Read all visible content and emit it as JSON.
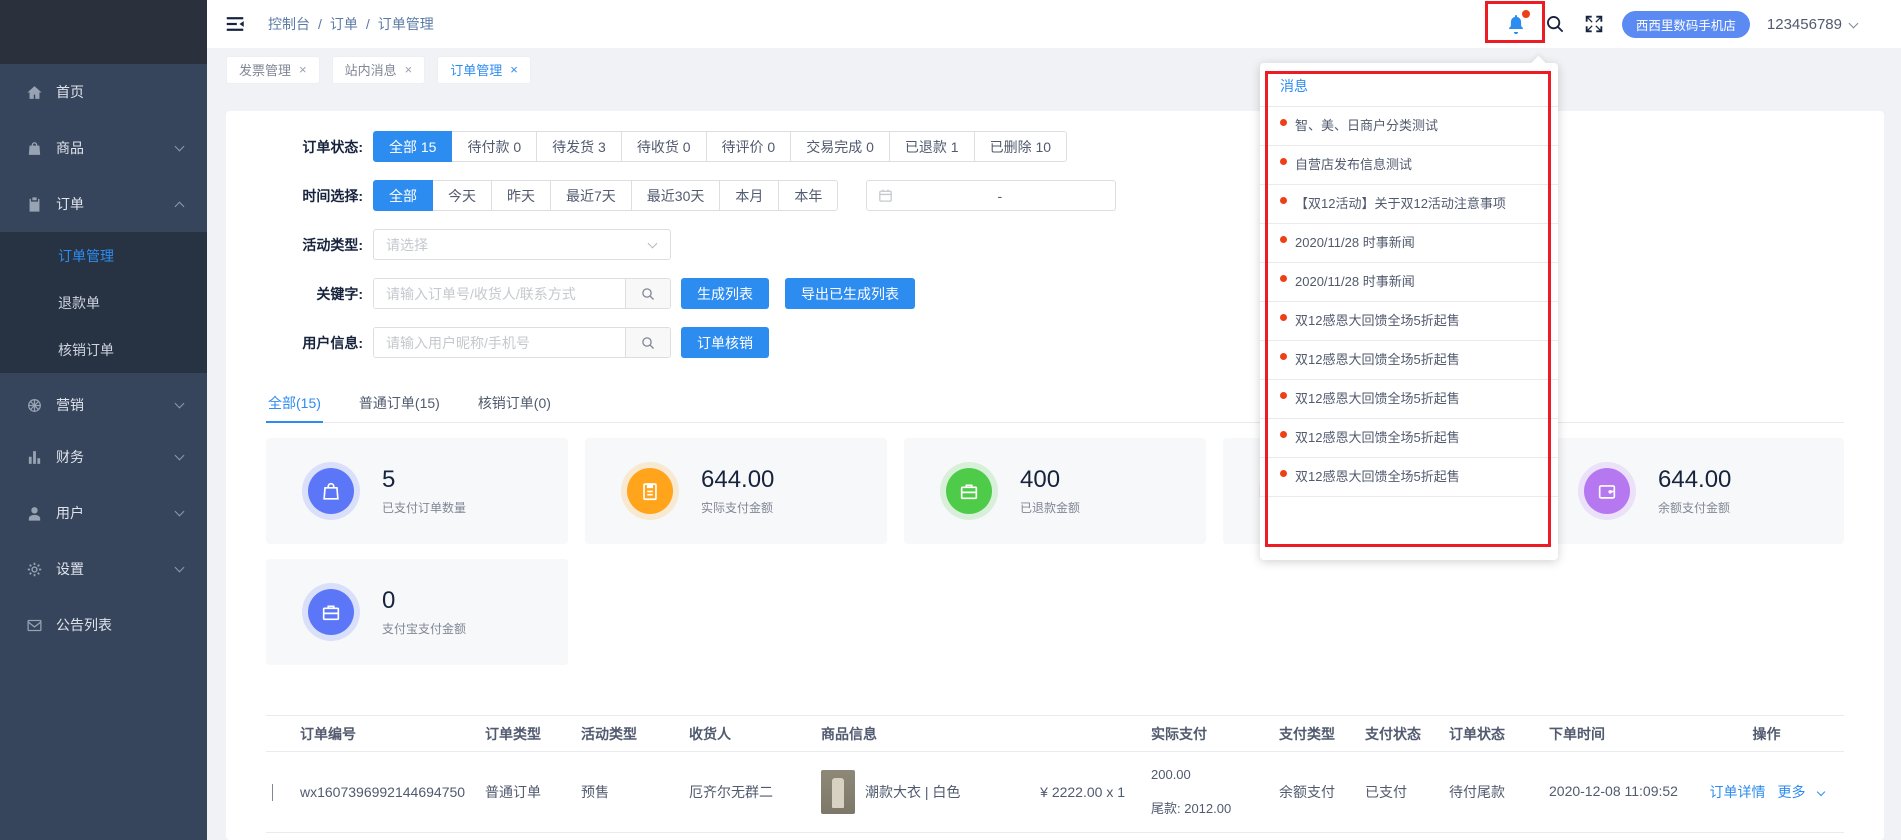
{
  "colors": {
    "accent": "#2d8cf0",
    "annotation_red": "#ed1c24",
    "unread_dot_red": "#ed4014",
    "sidebar_bg": "#36455b",
    "store_badge_bg": "#5a8af2"
  },
  "sidebar": {
    "items": [
      "首页",
      "商品",
      "订单",
      "营销",
      "财务",
      "用户",
      "设置",
      "公告列表"
    ],
    "order_submenu": [
      "订单管理",
      "退款单",
      "核销订单"
    ]
  },
  "header": {
    "breadcrumb": [
      "控制台",
      "订单",
      "订单管理"
    ],
    "separator": "/",
    "store_badge": "西西里数码手机店",
    "account": "123456789"
  },
  "tabbar": {
    "tabs": [
      "发票管理",
      "站内消息",
      "订单管理"
    ],
    "close_glyph": "×"
  },
  "filters": {
    "status_label": "订单状态:",
    "status_options": [
      "全部 15",
      "待付款 0",
      "待发货 3",
      "待收货 0",
      "待评价 0",
      "交易完成 0",
      "已退款 1",
      "已删除 10"
    ],
    "time_label": "时间选择:",
    "time_options": [
      "全部",
      "今天",
      "昨天",
      "最近7天",
      "最近30天",
      "本月",
      "本年"
    ],
    "range_separator": "-",
    "activity_label": "活动类型:",
    "activity_placeholder": "请选择",
    "keyword_label": "关键字:",
    "keyword_placeholder": "请输入订单号/收货人/联系方式",
    "generate_button": "生成列表",
    "export_button": "导出已生成列表",
    "user_label": "用户信息:",
    "user_placeholder": "请输入用户昵称/手机号",
    "verify_button": "订单核销"
  },
  "result_tabs": [
    "全部(15)",
    "普通订单(15)",
    "核销订单(0)"
  ],
  "stats": {
    "cards": [
      {
        "value": "5",
        "label": "已支付订单数量",
        "color": "#5b76f7"
      },
      {
        "value": "644.00",
        "label": "实际支付金额",
        "color": "#ffa41b"
      },
      {
        "value": "400",
        "label": "已退款金额",
        "color": "#4fcb4a"
      },
      {
        "value": "",
        "label": "",
        "color": "#f76fa8"
      },
      {
        "value": "644.00",
        "label": "余额支付金额",
        "color": "#b678f0"
      },
      {
        "value": "0",
        "label": "支付宝支付金额",
        "color": "#5b76f7"
      }
    ]
  },
  "notifications": {
    "title": "消息",
    "items": [
      "智、美、日商户分类测试",
      "自营店发布信息测试",
      "【双12活动】关于双12活动注意事项",
      "2020/11/28 时事新闻",
      "2020/11/28 时事新闻",
      "双12感恩大回馈全场5折起售",
      "双12感恩大回馈全场5折起售",
      "双12感恩大回馈全场5折起售",
      "双12感恩大回馈全场5折起售",
      "双12感恩大回馈全场5折起售"
    ]
  },
  "table": {
    "headers": [
      "订单编号",
      "订单类型",
      "活动类型",
      "收货人",
      "商品信息",
      "实际支付",
      "支付类型",
      "支付状态",
      "订单状态",
      "下单时间",
      "操作"
    ],
    "row": {
      "order_no": "wx1607396992144694750",
      "order_type": "普通订单",
      "activity": "预售",
      "consignee": "厄齐尔无群二",
      "product_name": "潮款大衣 | 白色",
      "price_qty": "¥ 2222.00 x 1",
      "paid_amount": "200.00",
      "paid_balance": "尾款: 2012.00",
      "pay_type": "余额支付",
      "pay_status": "已支付",
      "order_status": "待付尾款",
      "created_at": "2020-12-08 11:09:52",
      "action_detail": "订单详情",
      "action_more": "更多"
    }
  }
}
